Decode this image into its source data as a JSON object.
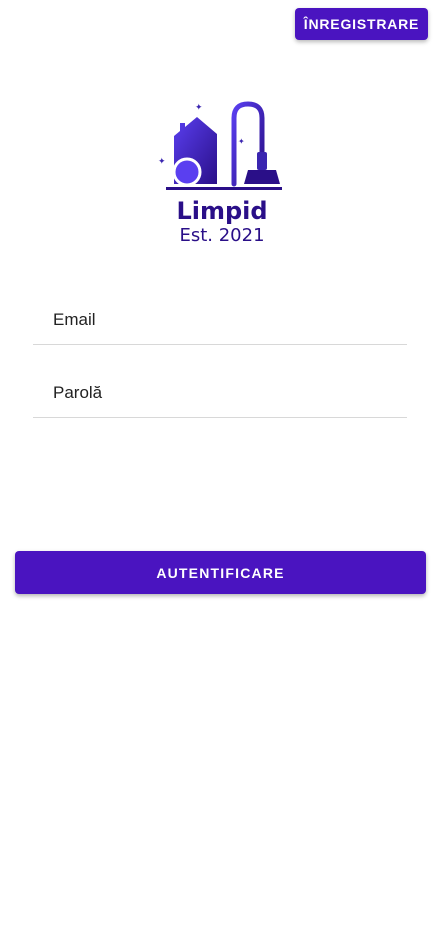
{
  "header": {
    "register_label": "ÎNREGISTRARE"
  },
  "logo": {
    "brand_name": "Limpid",
    "established": "Est. 2021",
    "icon": "house-vacuum-icon",
    "colors": {
      "light": "#5a3ff0",
      "dark": "#2a0f88"
    }
  },
  "form": {
    "email_placeholder": "Email",
    "email_value": "",
    "password_placeholder": "Parolă",
    "password_value": ""
  },
  "actions": {
    "login_label": "AUTENTIFICARE"
  },
  "theme": {
    "accent": "#4a14c0",
    "divider": "#d8d8d8",
    "background": "#ffffff"
  }
}
